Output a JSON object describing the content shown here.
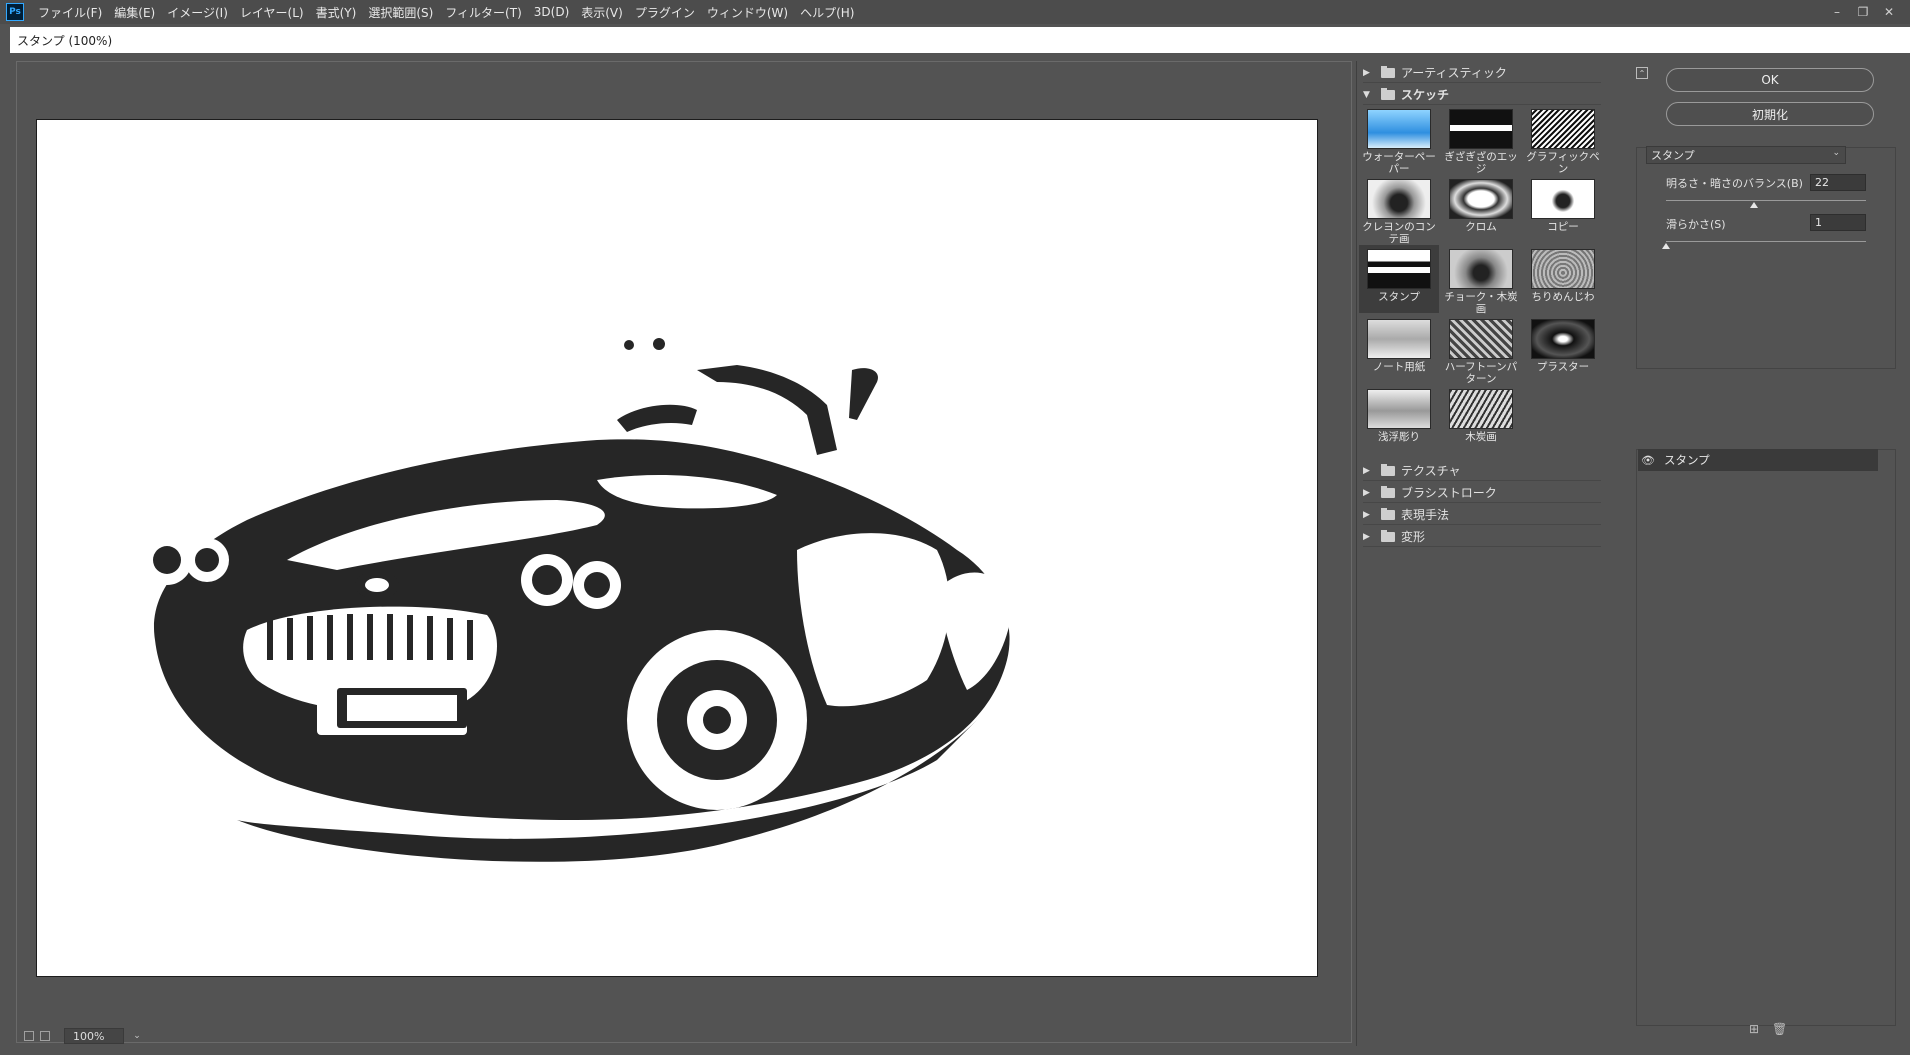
{
  "app": {
    "logo": "Ps"
  },
  "menu": [
    "ファイル(F)",
    "編集(E)",
    "イメージ(I)",
    "レイヤー(L)",
    "書式(Y)",
    "選択範囲(S)",
    "フィルター(T)",
    "3D(D)",
    "表示(V)",
    "プラグイン",
    "ウィンドウ(W)",
    "ヘルプ(H)"
  ],
  "window_controls": {
    "minimize": "–",
    "restore": "❐",
    "close": "✕"
  },
  "dialog": {
    "title": "スタンプ (100%)"
  },
  "preview": {
    "zoom": "100%",
    "content": "black-and-white stamp-filtered image of a classic convertible car"
  },
  "gallery": {
    "folders_top": [
      {
        "label": "アーティスティック",
        "expanded": false
      },
      {
        "label": "スケッチ",
        "expanded": true
      }
    ],
    "thumbnails": [
      {
        "label": "ウォーターペーパー",
        "selected": false
      },
      {
        "label": "ぎざぎざのエッジ",
        "selected": false
      },
      {
        "label": "グラフィックペン",
        "selected": false
      },
      {
        "label": "クレヨンのコンテ画",
        "selected": false
      },
      {
        "label": "クロム",
        "selected": false
      },
      {
        "label": "コピー",
        "selected": false
      },
      {
        "label": "スタンプ",
        "selected": true
      },
      {
        "label": "チョーク・木炭画",
        "selected": false
      },
      {
        "label": "ちりめんじわ",
        "selected": false
      },
      {
        "label": "ノート用紙",
        "selected": false
      },
      {
        "label": "ハーフトーンパターン",
        "selected": false
      },
      {
        "label": "プラスター",
        "selected": false
      },
      {
        "label": "浅浮彫り",
        "selected": false
      },
      {
        "label": "木炭画",
        "selected": false
      }
    ],
    "folders_bottom": [
      {
        "label": "テクスチャ",
        "expanded": false
      },
      {
        "label": "ブラシストローク",
        "expanded": false
      },
      {
        "label": "表現手法",
        "expanded": false
      },
      {
        "label": "変形",
        "expanded": false
      }
    ]
  },
  "controls": {
    "ok_label": "OK",
    "reset_label": "初期化",
    "filter_select": "スタンプ",
    "params": [
      {
        "label": "明るさ・暗さのバランス(B)",
        "value": "22",
        "slider_fraction": 0.44
      },
      {
        "label": "滑らかさ(S)",
        "value": "1",
        "slider_fraction": 0.0
      }
    ],
    "layer_name": "スタンプ"
  }
}
